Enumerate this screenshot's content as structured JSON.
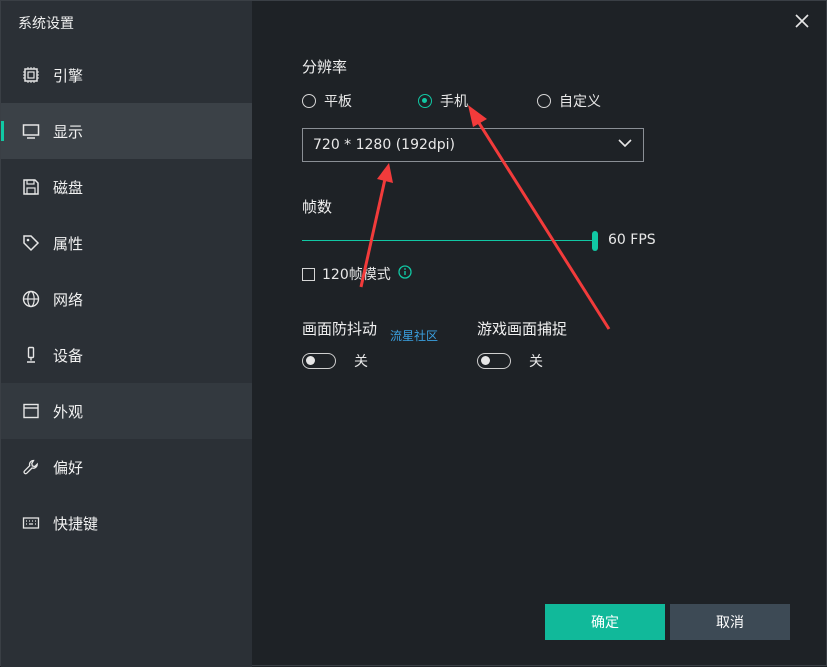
{
  "window": {
    "title": "系统设置"
  },
  "sidebar": {
    "items": [
      {
        "label": "引擎",
        "icon": "cpu-icon"
      },
      {
        "label": "显示",
        "icon": "monitor-icon"
      },
      {
        "label": "磁盘",
        "icon": "disk-icon"
      },
      {
        "label": "属性",
        "icon": "tag-icon"
      },
      {
        "label": "网络",
        "icon": "globe-icon"
      },
      {
        "label": "设备",
        "icon": "device-icon"
      },
      {
        "label": "外观",
        "icon": "window-icon"
      },
      {
        "label": "偏好",
        "icon": "wrench-icon"
      },
      {
        "label": "快捷键",
        "icon": "keyboard-icon"
      }
    ],
    "active_label": "显示",
    "hover_label": "外观"
  },
  "display": {
    "resolution": {
      "label": "分辨率",
      "options": [
        "平板",
        "手机",
        "自定义"
      ],
      "selected": "手机",
      "value": "720 * 1280 (192dpi)"
    },
    "fps": {
      "label": "帧数",
      "value_text": "60 FPS",
      "value_fraction": 1.0
    },
    "fps120": {
      "label": "120帧模式",
      "checked": false
    },
    "anti_shake": {
      "label": "画面防抖动",
      "state": "关",
      "on": false
    },
    "capture": {
      "label": "游戏画面捕捉",
      "state": "关",
      "on": false
    }
  },
  "watermark": "流星社区",
  "buttons": {
    "ok": "确定",
    "cancel": "取消"
  },
  "colors": {
    "accent": "#11c8a4",
    "sidebar": "#2b3036",
    "content_bg": "#1e2226",
    "arrow": "#f23b3b"
  }
}
